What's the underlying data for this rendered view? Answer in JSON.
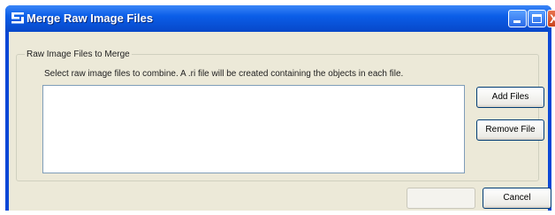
{
  "window": {
    "title": "Merge Raw Image Files",
    "icon": "app-icon",
    "controls": {
      "minimize": "minimize-icon",
      "maximize": "maximize-icon",
      "close_glyph": "X"
    }
  },
  "group": {
    "label": "Raw Image Files to Merge",
    "instructions": "Select raw image files to combine.  A .ri file will be created containing the objects in each file."
  },
  "file_list": {
    "items": []
  },
  "buttons": {
    "add_files": "Add Files",
    "remove_file": "Remove File",
    "ok": "",
    "cancel": "Cancel"
  },
  "colors": {
    "titlebar": "#0b5ee8",
    "dialog_background": "#ece9d8",
    "close_button": "#c9431d"
  }
}
